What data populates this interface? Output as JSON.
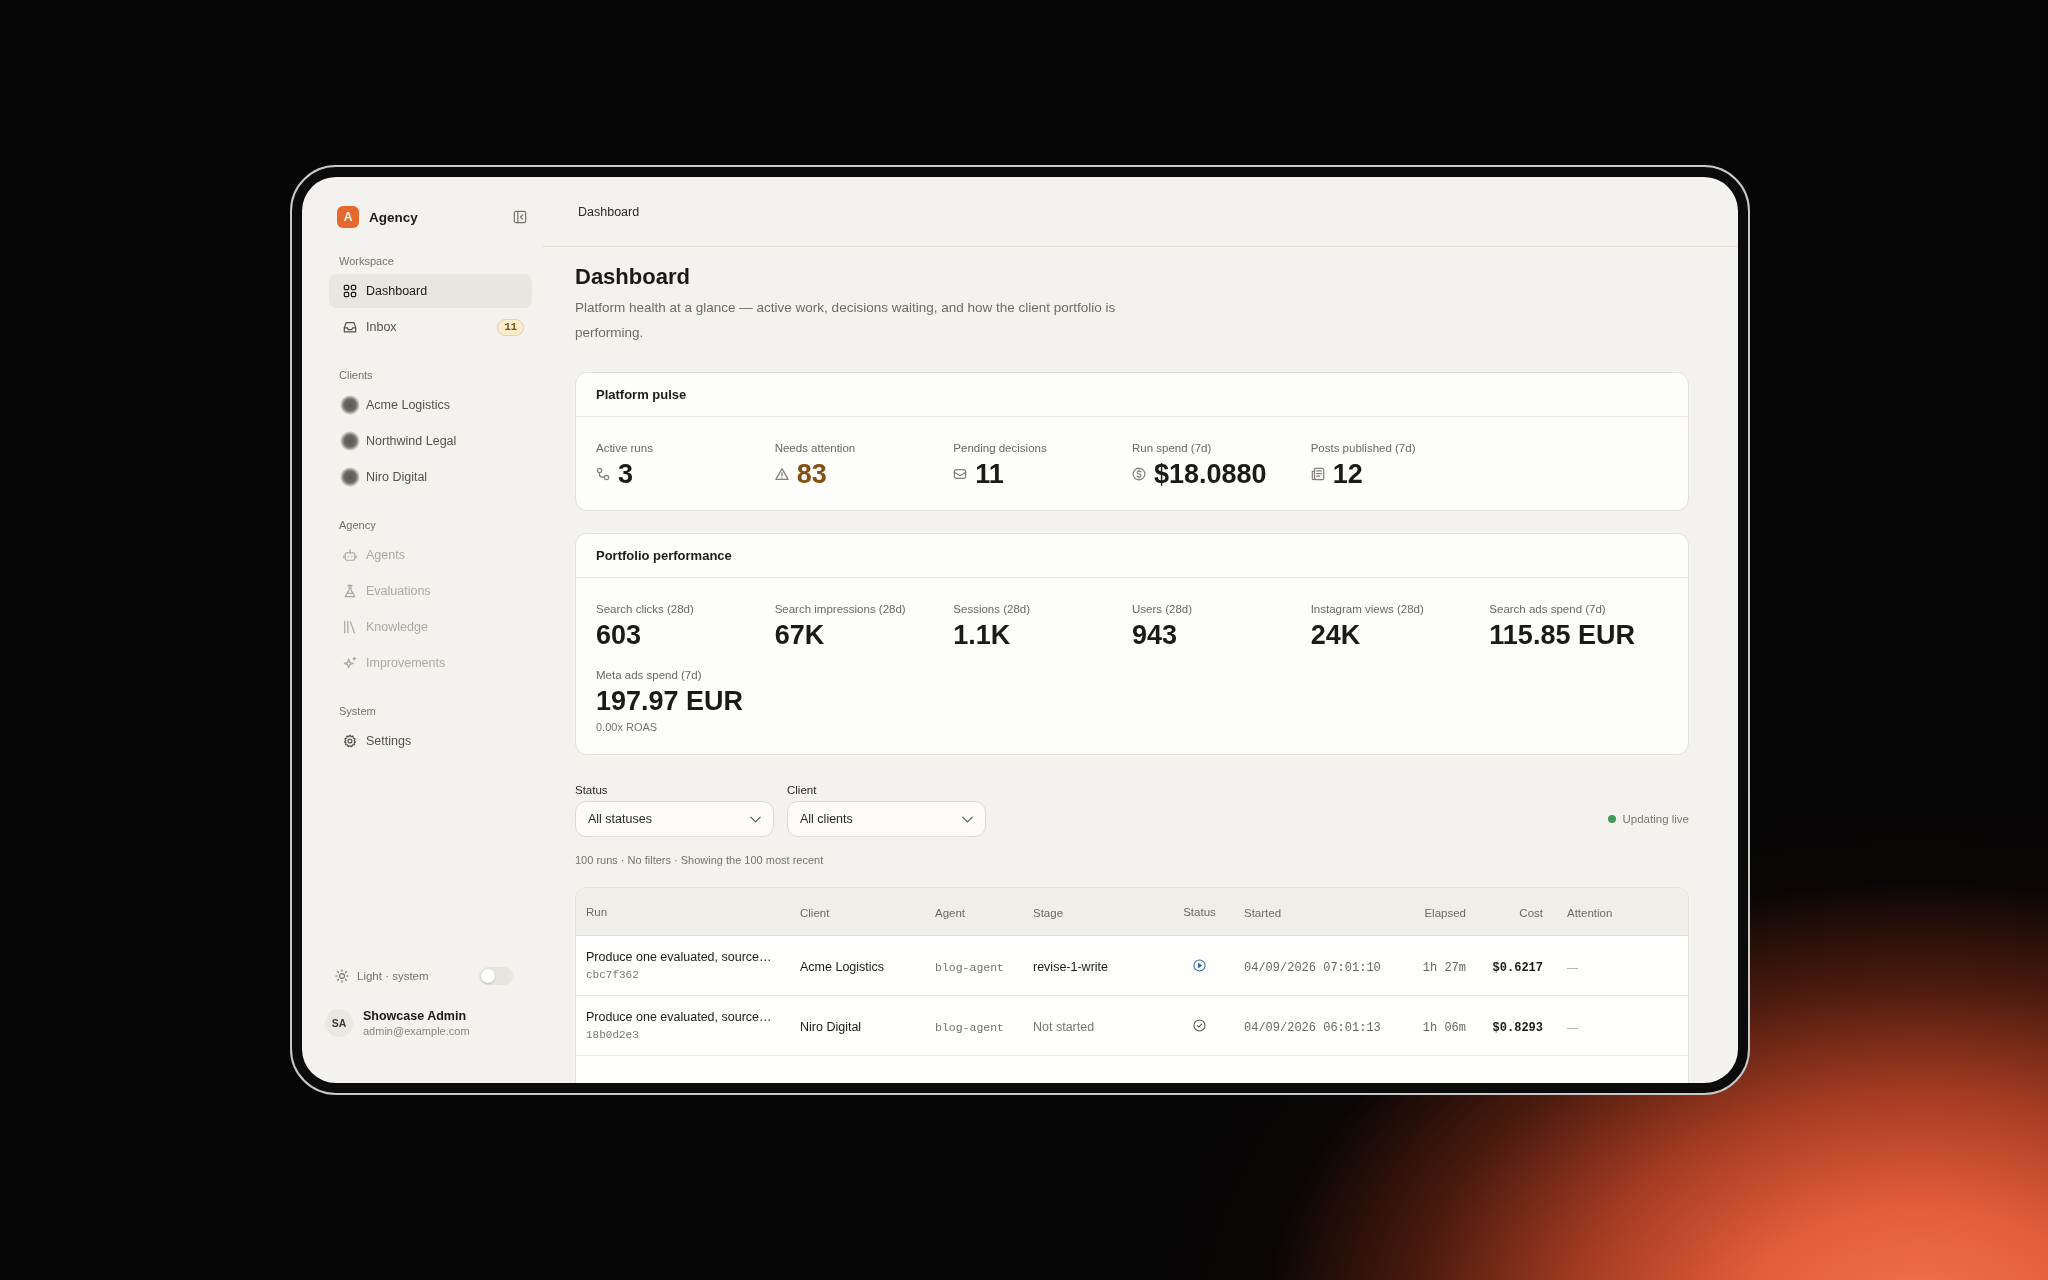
{
  "sidebar": {
    "brand": {
      "logo": "A",
      "name": "Agency"
    },
    "sections": [
      {
        "label": "Workspace",
        "items": [
          {
            "label": "Dashboard",
            "selected": true,
            "disabled": false
          },
          {
            "label": "Inbox",
            "selected": false,
            "disabled": false,
            "badge": "11"
          }
        ]
      },
      {
        "label": "Clients",
        "items": [
          {
            "label": "Acme Logistics",
            "selected": false,
            "disabled": false
          },
          {
            "label": "Northwind Legal",
            "selected": false,
            "disabled": false
          },
          {
            "label": "Niro Digital",
            "selected": false,
            "disabled": false
          }
        ]
      },
      {
        "label": "Agency",
        "items": [
          {
            "label": "Agents",
            "selected": false,
            "disabled": true
          },
          {
            "label": "Evaluations",
            "selected": false,
            "disabled": true
          },
          {
            "label": "Knowledge",
            "selected": false,
            "disabled": true
          },
          {
            "label": "Improvements",
            "selected": false,
            "disabled": true
          }
        ]
      },
      {
        "label": "System",
        "items": [
          {
            "label": "Settings",
            "selected": false,
            "disabled": false
          }
        ]
      }
    ],
    "theme": {
      "label": "Light · system",
      "on": false
    },
    "user": {
      "initials": "SA",
      "name": "Showcase Admin",
      "email": "admin@example.com"
    }
  },
  "topbar": {
    "breadcrumb": "Dashboard"
  },
  "page": {
    "title": "Dashboard",
    "subtitle": "Platform health at a glance — active work, decisions waiting, and how the client portfolio is performing."
  },
  "platform_pulse": {
    "title": "Platform pulse",
    "metrics": [
      {
        "label": "Active runs",
        "value": "3",
        "alert": false
      },
      {
        "label": "Needs attention",
        "value": "83",
        "alert": true
      },
      {
        "label": "Pending decisions",
        "value": "11",
        "alert": false
      },
      {
        "label": "Run spend (7d)",
        "value": "$18.0880",
        "alert": false
      },
      {
        "label": "Posts published (7d)",
        "value": "12",
        "alert": false
      }
    ]
  },
  "portfolio_performance": {
    "title": "Portfolio performance",
    "metrics": [
      {
        "label": "Search clicks (28d)",
        "value": "603"
      },
      {
        "label": "Search impressions (28d)",
        "value": "67K"
      },
      {
        "label": "Sessions (28d)",
        "value": "1.1K"
      },
      {
        "label": "Users (28d)",
        "value": "943"
      },
      {
        "label": "Instagram views (28d)",
        "value": "24K"
      },
      {
        "label": "Search ads spend (7d)",
        "value": "115.85 EUR"
      },
      {
        "label": "Meta ads spend (7d)",
        "value": "197.97 EUR",
        "note": "0.00x ROAS"
      }
    ]
  },
  "filters": [
    {
      "label": "Status",
      "value": "All statuses"
    },
    {
      "label": "Client",
      "value": "All clients"
    }
  ],
  "live_status": {
    "label": "Updating live",
    "active": true
  },
  "runs": {
    "summary": "100 runs · No filters · Showing the 100 most recent",
    "columns": [
      "Run",
      "Client",
      "Agent",
      "Stage",
      "Status",
      "Started",
      "Elapsed",
      "Cost",
      "Attention"
    ],
    "rows": [
      {
        "run": "Produce one evaluated, source…",
        "id": "cbc7f362",
        "client": "Acme Logistics",
        "agent": "blog-agent",
        "stage": "revise-1-write",
        "stage_started": true,
        "kind": "running",
        "started": "04/09/2026 07:01:10",
        "elapsed": "1h 27m",
        "cost": "$0.6217",
        "attention": "—"
      },
      {
        "run": "Produce one evaluated, source…",
        "id": "18b0d2e3",
        "client": "Niro Digital",
        "agent": "blog-agent",
        "stage": "Not started",
        "stage_started": false,
        "kind": "completed",
        "started": "04/09/2026 06:01:13",
        "elapsed": "1h 06m",
        "cost": "$0.8293",
        "attention": "—"
      }
    ]
  }
}
